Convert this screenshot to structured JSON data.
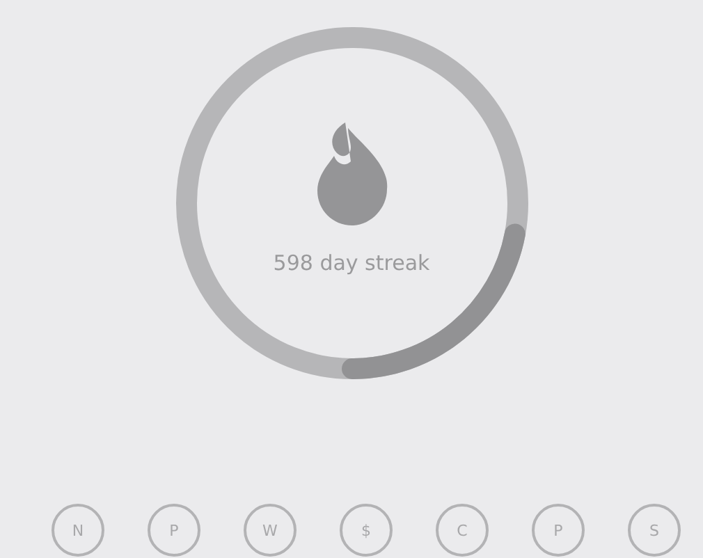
{
  "streak": {
    "label": "598 day streak",
    "level": 0.22
  },
  "habits": [
    {
      "letter": "N"
    },
    {
      "letter": "P"
    },
    {
      "letter": "W"
    },
    {
      "letter": "$"
    },
    {
      "letter": "C"
    },
    {
      "letter": "P"
    },
    {
      "letter": "S"
    }
  ]
}
